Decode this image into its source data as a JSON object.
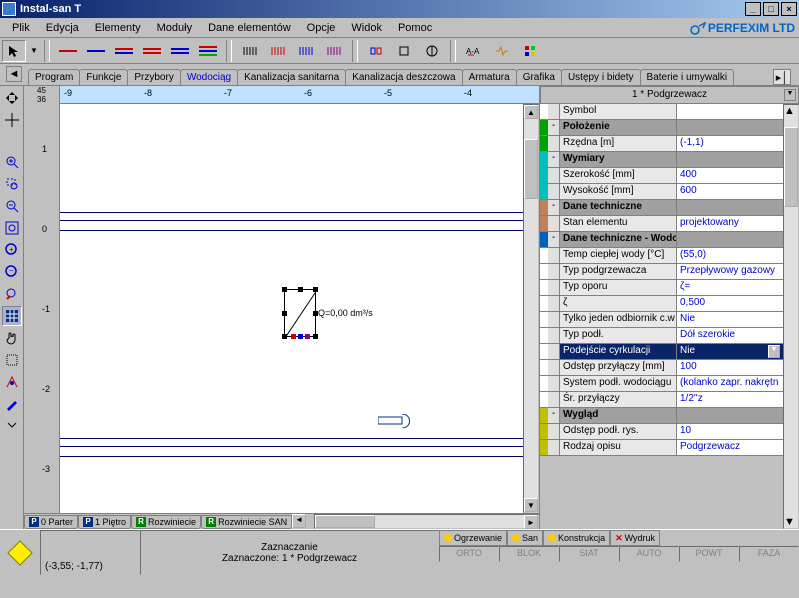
{
  "title": "Instal-san T",
  "menu": [
    "Plik",
    "Edycja",
    "Elementy",
    "Moduły",
    "Dane elementów",
    "Opcje",
    "Widok",
    "Pomoc"
  ],
  "logo": "PERFEXIM LTD",
  "tabs_top": [
    "Program",
    "Funkcje",
    "Przybory",
    "Wodociąg",
    "Kanalizacja sanitarna",
    "Kanalizacja deszczowa",
    "Armatura",
    "Grafika",
    "Ustępy i bidety",
    "Baterie i umywalki"
  ],
  "tabs_top_active": 3,
  "ruler_h_corner": [
    "45",
    "36"
  ],
  "ruler_h": [
    "-9",
    "-8",
    "-7",
    "-6",
    "-5",
    "-4"
  ],
  "ruler_v": [
    "1",
    "0",
    "-1",
    "-2",
    "-3"
  ],
  "element_label": "Q=0,00 dm³/s",
  "bottom_tabs": [
    {
      "box": "P",
      "boxcolor": "#003080",
      "text": "0 Parter"
    },
    {
      "box": "P",
      "boxcolor": "#003080",
      "text": "1 Piętro"
    },
    {
      "box": "R",
      "boxcolor": "#008000",
      "text": "Rozwiniecie"
    },
    {
      "box": "R",
      "boxcolor": "#008000",
      "text": "Rozwiniecie SAN"
    }
  ],
  "props_title": "1 * Podgrzewacz",
  "props": [
    {
      "type": "row",
      "color": "#ffffff",
      "label": "Symbol",
      "value": ""
    },
    {
      "type": "section",
      "color": "#00a000",
      "label": "Położenie"
    },
    {
      "type": "row",
      "color": "#00a000",
      "label": "Rzędna [m]",
      "value": "(-1,1)"
    },
    {
      "type": "section",
      "color": "#00c0c0",
      "label": "Wymiary"
    },
    {
      "type": "row",
      "color": "#00c0c0",
      "label": "Szerokość [mm]",
      "value": "400"
    },
    {
      "type": "row",
      "color": "#00c0c0",
      "label": "Wysokość [mm]",
      "value": "600"
    },
    {
      "type": "section",
      "color": "#c08060",
      "label": "Dane techniczne"
    },
    {
      "type": "row",
      "color": "#c08060",
      "label": "Stan elementu",
      "value": "projektowany"
    },
    {
      "type": "section",
      "color": "#0060c0",
      "label": "Dane techniczne - Wodociąg"
    },
    {
      "type": "row",
      "color": "#ffffff",
      "label": "Temp ciepłej wody [°C]",
      "value": "(55,0)"
    },
    {
      "type": "row",
      "color": "#ffffff",
      "label": "Typ podgrzewacza",
      "value": "Przepływowy gazowy"
    },
    {
      "type": "row",
      "color": "#ffffff",
      "label": "Typ oporu",
      "value": "ζ="
    },
    {
      "type": "row",
      "color": "#ffffff",
      "label": "ζ",
      "value": "0,500"
    },
    {
      "type": "row",
      "color": "#ffffff",
      "label": "Tylko jeden odbiornik c.w",
      "value": "Nie"
    },
    {
      "type": "row",
      "color": "#ffffff",
      "label": "Typ podł.",
      "value": "Dół szerokie"
    },
    {
      "type": "selrow",
      "color": "#ffffff",
      "label": "Podejście cyrkulacji",
      "value": "Nie"
    },
    {
      "type": "row",
      "color": "#ffffff",
      "label": "Odstęp przyłączy [mm]",
      "value": "100"
    },
    {
      "type": "row",
      "color": "#ffffff",
      "label": "System podł. wodociągu",
      "value": "(kolanko zapr. nakrętn"
    },
    {
      "type": "row",
      "color": "#ffffff",
      "label": "Śr. przyłączy",
      "value": "1/2''z"
    },
    {
      "type": "section",
      "color": "#c0c000",
      "label": "Wygląd"
    },
    {
      "type": "row",
      "color": "#c0c000",
      "label": "Odstęp podł. rys.",
      "value": "10"
    },
    {
      "type": "row",
      "color": "#c0c000",
      "label": "Rodzaj opisu",
      "value": "Podgrzewacz"
    }
  ],
  "status": {
    "coord": "(-3,55; -1,77)",
    "mode": "Zaznaczanie",
    "selection": "Zaznaczone: 1 * Podgrzewacz"
  },
  "layer_tabs": [
    {
      "dot": "#ffcc00",
      "text": "Ogrzewanie"
    },
    {
      "dot": "#ffcc00",
      "text": "San"
    },
    {
      "dot": "#ffcc00",
      "text": "Konstrukcja"
    },
    {
      "dot": "#ff0000",
      "text": "Wydruk",
      "x": true
    }
  ],
  "layer_boxes": [
    "ORTO",
    "BLOK",
    "SIAT",
    "AUTO",
    "POWT",
    "FAZA"
  ]
}
